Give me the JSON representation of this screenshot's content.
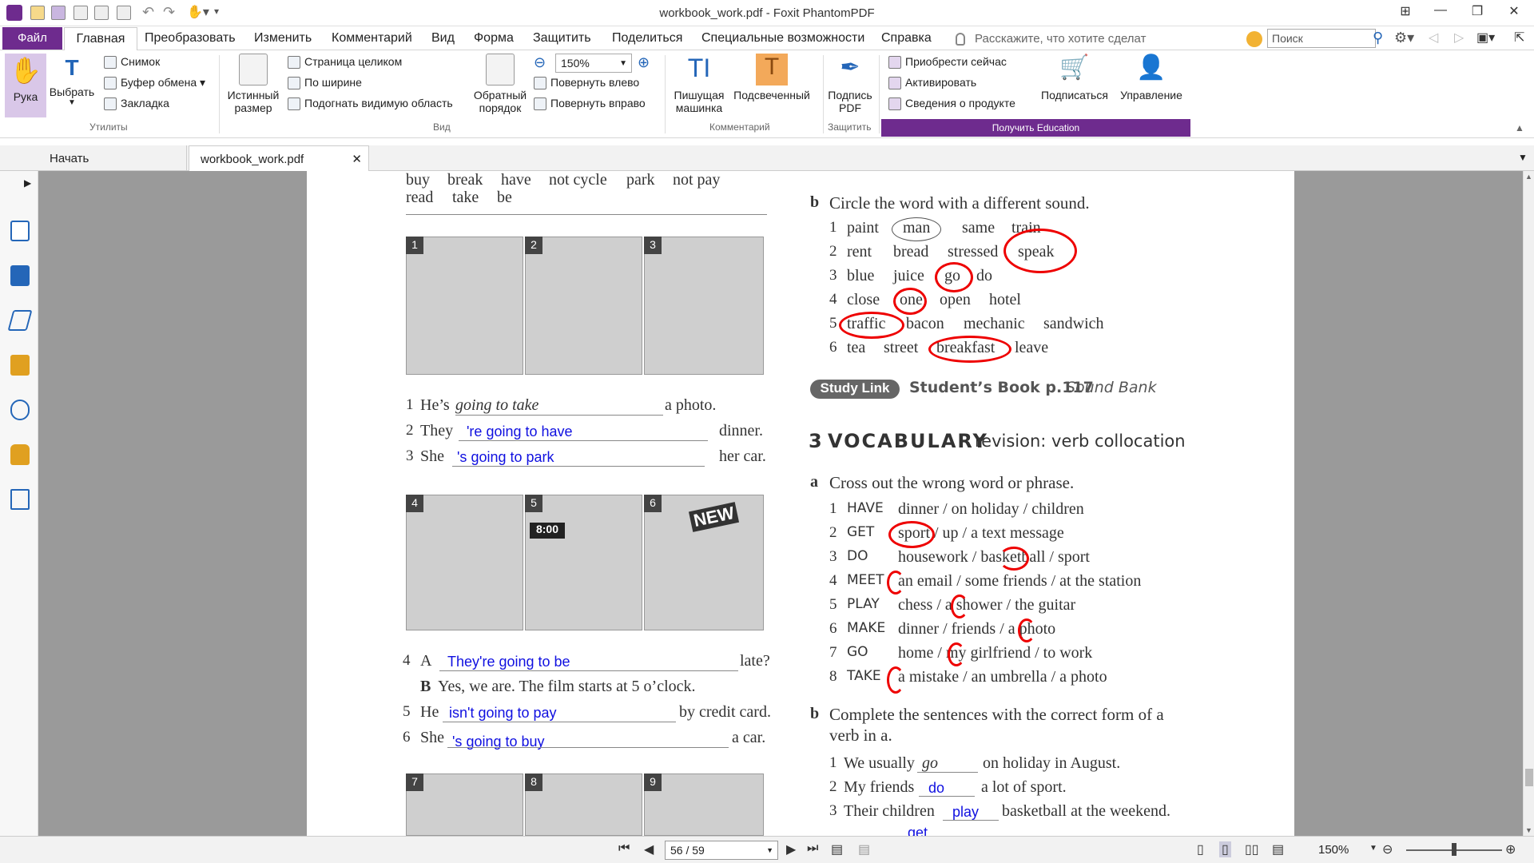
{
  "window": {
    "title": "workbook_work.pdf - Foxit PhantomPDF"
  },
  "menu": {
    "file": "Файл",
    "items": [
      "Главная",
      "Преобразовать",
      "Изменить",
      "Комментарий",
      "Вид",
      "Форма",
      "Защитить",
      "Поделиться",
      "Специальные возможности",
      "Справка"
    ],
    "search_hint": "Расскажите, что хотите сделат",
    "search_placeholder": "Поиск"
  },
  "ribbon": {
    "hand": "Рука",
    "select": "Выбрать",
    "snapshot": "Снимок",
    "clipboard": "Буфер обмена",
    "bookmark": "Закладка",
    "group_utilities": "Утилиты",
    "actual_size_1": "Истинный",
    "actual_size_2": "размер",
    "fit_page": "Страница целиком",
    "fit_width": "По ширине",
    "fit_visible": "Подогнать видимую область",
    "reverse_1": "Обратный",
    "reverse_2": "порядок",
    "zoom_value": "150%",
    "rotate_left": "Повернуть влево",
    "rotate_right": "Повернуть вправо",
    "group_view": "Вид",
    "typewriter_1": "Пишущая",
    "typewriter_2": "машинка",
    "highlight": "Подсвеченный",
    "group_comment": "Комментарий",
    "sign_1": "Подпись",
    "sign_2": "PDF",
    "group_protect": "Защитить",
    "buy_now": "Приобрести сейчас",
    "activate": "Активировать",
    "product_info": "Сведения о продукте",
    "subscribe": "Подписаться",
    "manage": "Управление",
    "edu_banner": "Получить Education"
  },
  "tabs": {
    "start": "Начать",
    "doc": "workbook_work.pdf"
  },
  "pdf_left": {
    "word_row1": [
      "buy",
      "break",
      "have",
      "not cycle",
      "park",
      "not pay"
    ],
    "word_row2": [
      "read",
      "take",
      "be"
    ],
    "pic_nums_a": [
      "1",
      "2",
      "3"
    ],
    "pic_nums_b": [
      "4",
      "5",
      "6"
    ],
    "pic_nums_c": [
      "7",
      "8",
      "9"
    ],
    "clock_text": "8:00",
    "new_text": "NEW",
    "s1_num": "1",
    "s1_pre": "He’s",
    "s1_italic": "going to take",
    "s1_end": "a photo.",
    "s2_num": "2",
    "s2_pre": "They",
    "s2_ans": "'re going to have",
    "s2_end": "dinner.",
    "s3_num": "3",
    "s3_pre": "She",
    "s3_ans": "'s going to park",
    "s3_end": "her car.",
    "s4_num": "4",
    "s4_pre": "A",
    "s4_ans": "They're going to be",
    "s4_end": "late?",
    "s4b_pre": "B",
    "s4b_text": "Yes, we are. The film starts at 5 o’clock.",
    "s5_num": "5",
    "s5_pre": "He",
    "s5_ans": "isn't going to pay",
    "s5_end": "by credit card.",
    "s6_num": "6",
    "s6_pre": "She",
    "s6_ans": "'s going to buy",
    "s6_end": "a car."
  },
  "pdf_right": {
    "b_letter": "b",
    "b_title": "Circle the word with a different sound.",
    "sound_rows": [
      {
        "n": "1",
        "w": [
          "paint",
          "man",
          "same",
          "train"
        ]
      },
      {
        "n": "2",
        "w": [
          "rent",
          "bread",
          "stressed",
          "speak"
        ]
      },
      {
        "n": "3",
        "w": [
          "blue",
          "juice",
          "go",
          "do"
        ]
      },
      {
        "n": "4",
        "w": [
          "close",
          "one",
          "open",
          "hotel"
        ]
      },
      {
        "n": "5",
        "w": [
          "traffic",
          "bacon",
          "mechanic",
          "sandwich"
        ]
      },
      {
        "n": "6",
        "w": [
          "tea",
          "street",
          "breakfast",
          "leave"
        ]
      }
    ],
    "study_link": "Study Link",
    "students_book": "Student’s Book p.117",
    "sound_bank": "Sound Bank",
    "vocab_num": "3",
    "vocab_title": "VOCABULARY",
    "vocab_sub": "revision: verb collocation",
    "a_letter": "a",
    "a_title": "Cross out the wrong word or phrase.",
    "vocab_rows": [
      {
        "n": "1",
        "v": "HAVE",
        "o": "dinner  /  on holiday  /  children"
      },
      {
        "n": "2",
        "v": "GET",
        "o": "sport  /  up  /  a text message"
      },
      {
        "n": "3",
        "v": "DO",
        "o": "housework  /  basketball  /  sport"
      },
      {
        "n": "4",
        "v": "MEET",
        "o": "an email  /  some friends  /  at the station"
      },
      {
        "n": "5",
        "v": "PLAY",
        "o": "chess  /  a shower  /  the guitar"
      },
      {
        "n": "6",
        "v": "MAKE",
        "o": "dinner  /  friends  /  a photo"
      },
      {
        "n": "7",
        "v": "GO",
        "o": "home  /  my girlfriend  /  to work"
      },
      {
        "n": "8",
        "v": "TAKE",
        "o": "a mistake  /  an umbrella  /  a photo"
      }
    ],
    "b2_letter": "b",
    "b2_title_1": "Complete the sentences with the correct form of a",
    "b2_title_2": "verb in a.",
    "c1_num": "1",
    "c1_pre": "We usually",
    "c1_ans": "go",
    "c1_end": "on holiday in August.",
    "c2_num": "2",
    "c2_pre": "My friends",
    "c2_ans": "do",
    "c2_end": "a lot of sport.",
    "c3_num": "3",
    "c3_pre": "Their children",
    "c3_ans": "play",
    "c3_end": "basketball at the weekend.",
    "c4_ans": "get"
  },
  "status": {
    "page": "56 / 59",
    "zoom": "150%"
  }
}
